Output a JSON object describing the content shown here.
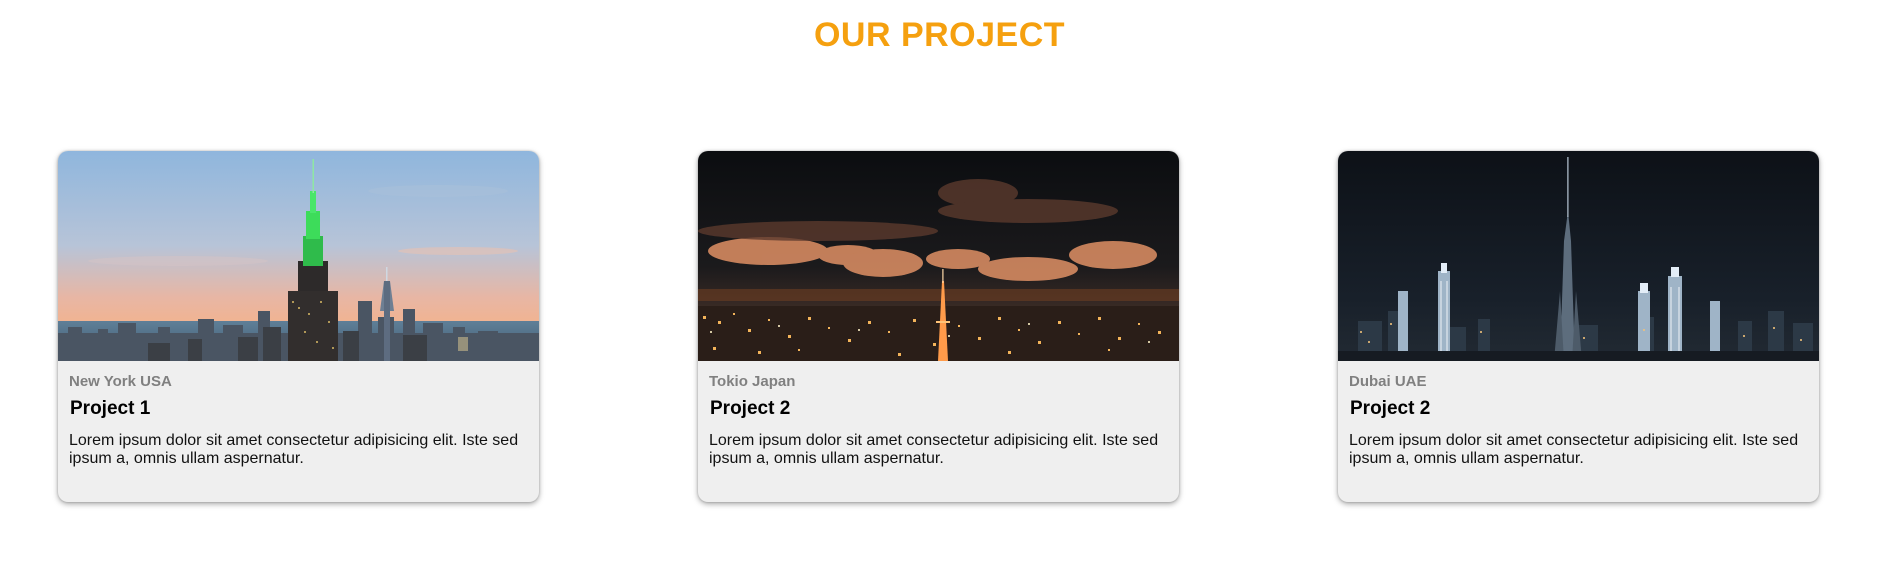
{
  "section": {
    "title": "OUR PROJECT",
    "title_color": "#f5a00f"
  },
  "cards": [
    {
      "location": "New York USA",
      "title": "Project 1",
      "description": "Lorem ipsum dolor sit amet consectetur adipisicing elit. Iste sed ipsum a, omnis ullam aspernatur.",
      "image": "new-york-skyline-dusk"
    },
    {
      "location": "Tokio Japan",
      "title": "Project 2",
      "description": "Lorem ipsum dolor sit amet consectetur adipisicing elit. Iste sed ipsum a, omnis ullam aspernatur.",
      "image": "tokyo-city-night"
    },
    {
      "location": "Dubai UAE",
      "title": "Project 2",
      "description": "Lorem ipsum dolor sit amet consectetur adipisicing elit. Iste sed ipsum a, omnis ullam aspernatur.",
      "image": "dubai-skyline-night"
    }
  ]
}
